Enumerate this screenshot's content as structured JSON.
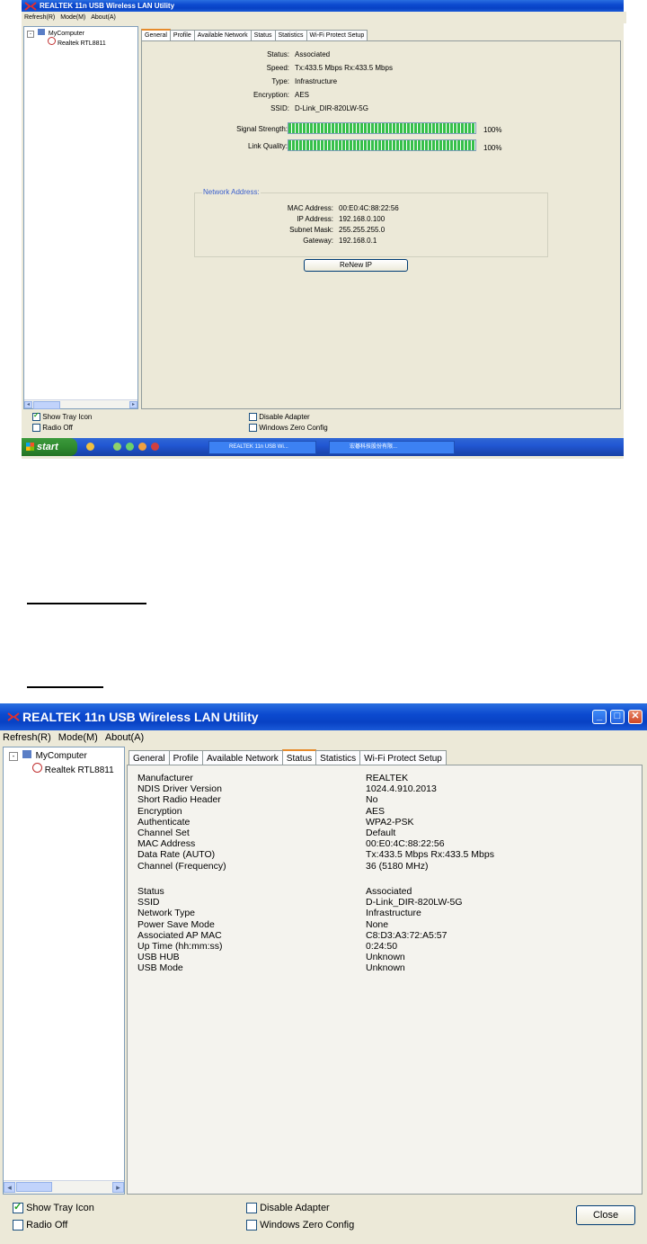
{
  "app_title": "REALTEK 11n USB Wireless LAN Utility",
  "menu": [
    "Refresh(R)",
    "Mode(M)",
    "About(A)"
  ],
  "tree": {
    "root": "MyComputer",
    "child": "Realtek RTL8811"
  },
  "tabs": [
    "General",
    "Profile",
    "Available Network",
    "Status",
    "Statistics",
    "Wi-Fi Protect Setup"
  ],
  "general": {
    "rows": [
      {
        "label": "Status:",
        "value": "Associated"
      },
      {
        "label": "Speed:",
        "value": "Tx:433.5 Mbps Rx:433.5 Mbps"
      },
      {
        "label": "Type:",
        "value": "Infrastructure"
      },
      {
        "label": "Encryption:",
        "value": "AES"
      },
      {
        "label": "SSID:",
        "value": "D-Link_DIR-820LW-5G"
      }
    ],
    "signal_label": "Signal Strength:",
    "signal_value": "100%",
    "signal_level": 1.0,
    "quality_label": "Link Quality:",
    "quality_value": "100%",
    "quality_level": 1.0,
    "network_address_title": "Network Address:",
    "net_rows": [
      {
        "label": "MAC Address:",
        "value": "00:E0:4C:88:22:56"
      },
      {
        "label": "IP Address:",
        "value": "192.168.0.100"
      },
      {
        "label": "Subnet Mask:",
        "value": "255.255.255.0"
      },
      {
        "label": "Gateway:",
        "value": "192.168.0.1"
      }
    ],
    "renew_button": "ReNew IP"
  },
  "options": {
    "show_tray_icon": "Show Tray Icon",
    "show_tray_icon_checked": true,
    "radio_off": "Radio Off",
    "radio_off_checked": false,
    "disable_adapter": "Disable Adapter",
    "disable_adapter_checked": false,
    "windows_zero_config": "Windows Zero Config",
    "windows_zero_config_checked": false
  },
  "taskbar": {
    "start": "start",
    "task1": "REALTEK 11n USB Wi...",
    "task2": "宏碁科技股份有限..."
  },
  "status": {
    "group1": [
      {
        "label": "Manufacturer",
        "value": "REALTEK"
      },
      {
        "label": "NDIS Driver Version",
        "value": "1024.4.910.2013"
      },
      {
        "label": "Short Radio Header",
        "value": "No"
      },
      {
        "label": "Encryption",
        "value": "AES"
      },
      {
        "label": "Authenticate",
        "value": "WPA2-PSK"
      },
      {
        "label": "Channel Set",
        "value": "Default"
      },
      {
        "label": "MAC Address",
        "value": "00:E0:4C:88:22:56"
      },
      {
        "label": "Data Rate (AUTO)",
        "value": "Tx:433.5 Mbps Rx:433.5 Mbps"
      },
      {
        "label": "Channel (Frequency)",
        "value": "36 (5180 MHz)"
      }
    ],
    "group2": [
      {
        "label": "Status",
        "value": "Associated"
      },
      {
        "label": "SSID",
        "value": "D-Link_DIR-820LW-5G"
      },
      {
        "label": "Network Type",
        "value": "Infrastructure"
      },
      {
        "label": "Power Save Mode",
        "value": "None"
      },
      {
        "label": "Associated AP MAC",
        "value": "C8:D3:A3:72:A5:57"
      },
      {
        "label": "Up Time (hh:mm:ss)",
        "value": "0:24:50"
      },
      {
        "label": "USB HUB",
        "value": "Unknown"
      },
      {
        "label": "USB Mode",
        "value": "Unknown"
      }
    ]
  },
  "close_button": "Close",
  "colors": {
    "title_blue": "#0842c4",
    "xp_beige": "#ece9d8",
    "signal_green": "#36c04a",
    "net_title": "#3a5fcd"
  }
}
